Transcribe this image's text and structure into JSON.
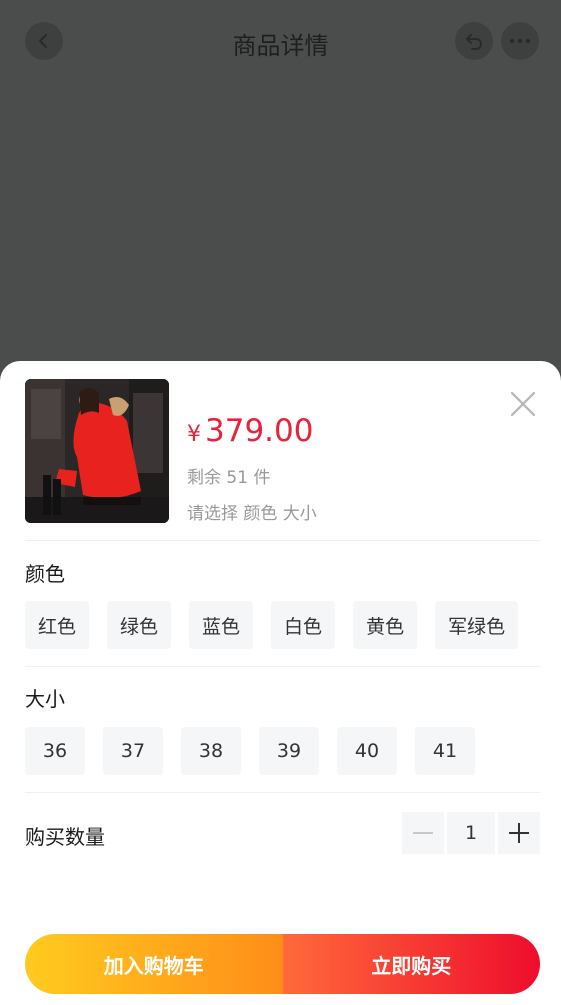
{
  "nav": {
    "title": "商品详情",
    "back_icon": "chevron-left-icon",
    "share_icon": "undo-share-icon",
    "more_icon": "more-dots-icon"
  },
  "product": {
    "currency": "¥",
    "price": "379.00",
    "stock": "剩余 51 件",
    "select_hint": "请选择 颜色 大小"
  },
  "color": {
    "title": "颜色",
    "options": [
      "红色",
      "绿色",
      "蓝色",
      "白色",
      "黄色",
      "军绿色"
    ]
  },
  "size": {
    "title": "大小",
    "options": [
      "36",
      "37",
      "38",
      "39",
      "40",
      "41"
    ]
  },
  "quantity": {
    "label": "购买数量",
    "value": "1"
  },
  "actions": {
    "add_cart": "加入购物车",
    "buy_now": "立即购买"
  },
  "colors": {
    "accent": "#e8223b",
    "cart_gradient": [
      "#ffcb1f",
      "#ff8d18"
    ],
    "buy_gradient": [
      "#ff6a3a",
      "#ee0d2c"
    ]
  }
}
